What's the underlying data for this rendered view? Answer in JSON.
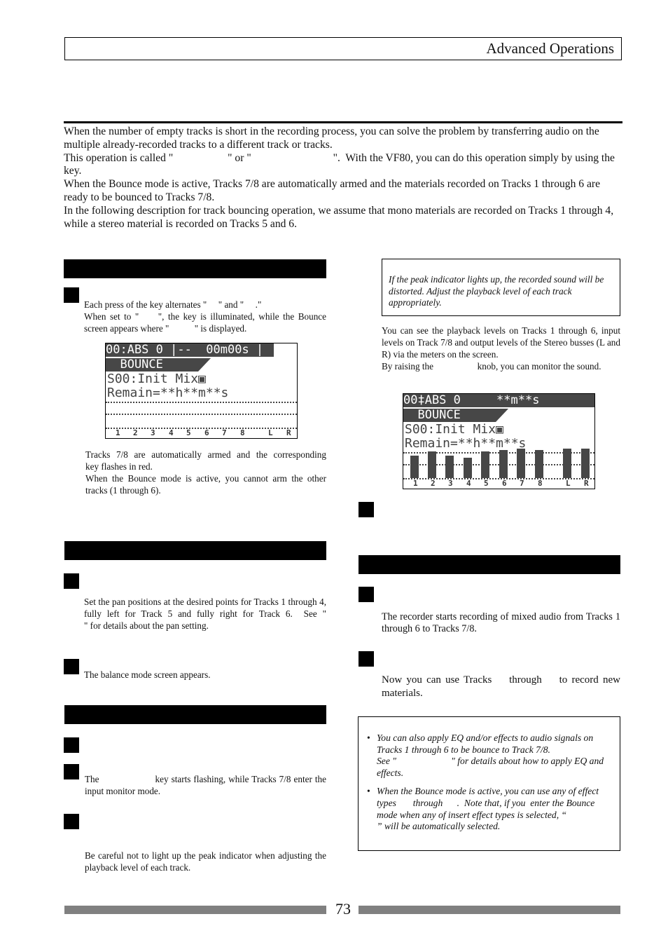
{
  "header": {
    "title": "Advanced Operations"
  },
  "intro": [
    "When the number of empty tracks is short in the recording process, you can solve the problem by transferring audio on the multiple already-recorded tracks to a different track or tracks.",
    "This operation is called \"                    \" or \"                              \".  With the VF80, you can do this operation simply by using the                 key.",
    "When the Bounce mode is active, Tracks 7/8 are automatically armed and the materials recorded on Tracks 1 through 6 are ready to be bounced to Tracks 7/8.",
    "In the following description for track bouncing operation, we assume that mono materials are recorded on Tracks 1 through 4, while a stereo material is recorded on Tracks 5 and 6."
  ],
  "left": {
    "section1": {
      "step1_text": "Each press of the key alternates \"     \" and \"     .\"\nWhen set to \"     \", the key is illuminated, while the Bounce screen appears where \"           \" is displayed.",
      "after_screen_text": "Tracks 7/8 are automatically armed and the corresponding                                          key flashes in red.\nWhen the Bounce mode is active, you cannot arm the other tracks (1 through 6)."
    },
    "section2": {
      "step1_text": "Set the pan positions at the desired points for Tracks 1 through 4, fully left for Track 5 and fully right for Track 6.  See \"                         \" for details about the pan setting.",
      "step2_text": "The balance mode screen appears."
    },
    "section3": {
      "step2_text": "The                    key starts flashing, while Tracks 7/8 enter the input monitor mode.",
      "step3_text": "Be careful not to light up the peak indicator when adjusting the playback level of each track."
    }
  },
  "lcd1": {
    "row1": "00:ABS 0 |--  00m00s |",
    "row2": "  BOUNCE",
    "row3": "S00:Init Mix▣",
    "row4": "Remain=**h**m**s",
    "labels": [
      "1",
      "2",
      "3",
      "4",
      "5",
      "6",
      "7",
      "8",
      "L",
      "R"
    ]
  },
  "lcd2": {
    "row1": "00‡ABS 0     **m**s",
    "row2": "  BOUNCE",
    "row3": "S00:Init Mix▣",
    "row4": "Remain=**h**m**s",
    "labels": [
      "1",
      "2",
      "3",
      "4",
      "5",
      "6",
      "7",
      "8",
      "L",
      "R"
    ],
    "meter_levels": [
      0.62,
      0.74,
      0.62,
      0.55,
      0.74,
      0.77,
      0.8,
      0.77,
      0.8,
      0.8
    ]
  },
  "right": {
    "caution": "If the peak indicator lights up, the recorded sound will be distorted. Adjust the playback level of each track appropriately.",
    "meters_text": "You can see the playback levels on Tracks 1 through 6, input levels on Track 7/8 and output levels of the Stereo busses (L and R) via the meters on the screen.\nBy raising the                   knob, you can monitor the sound.",
    "section4": {
      "step1_text": "The recorder starts recording of mixed audio from Tracks 1 through 6 to Tracks 7/8.",
      "step2_text": "Now you can use Tracks    through    to record new materials."
    },
    "notes": [
      "You can also apply EQ and/or effects to audio signals on Tracks 1 through 6 to be bounce to Track 7/8.\nSee \"                       \" for details about how to apply EQ and effects.",
      "When the Bounce mode is active, you can use any of effect types       through      .  Note that, if you  enter the Bounce mode when any of insert effect types is selected, “                        ” will be automatically selected."
    ]
  },
  "footer": {
    "page_number": "73"
  }
}
